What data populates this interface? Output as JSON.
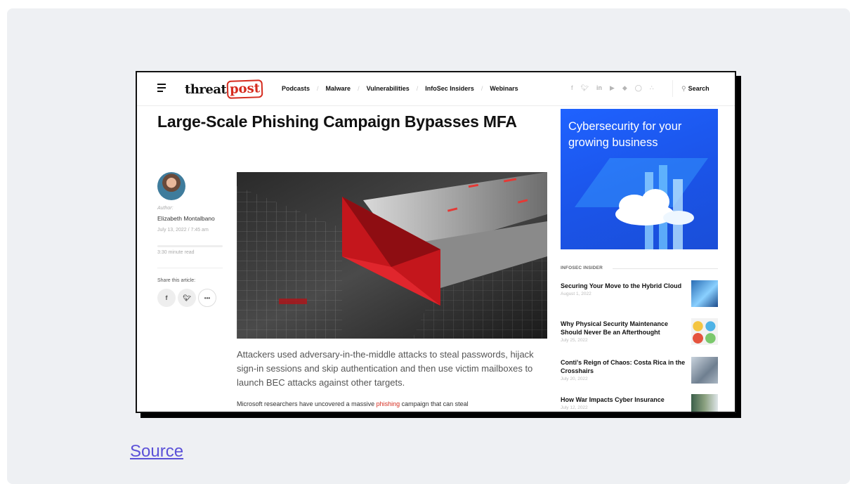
{
  "nav": {
    "logo_part1": "threat",
    "logo_part2": "post",
    "items": [
      "Podcasts",
      "Malware",
      "Vulnerabilities",
      "InfoSec Insiders",
      "Webinars"
    ],
    "social_icons": [
      "facebook-icon",
      "twitter-icon",
      "linkedin-icon",
      "youtube-icon",
      "feedly-icon",
      "instagram-icon",
      "rss-icon"
    ],
    "search_label": "Search"
  },
  "article": {
    "title": "Large-Scale Phishing Campaign Bypasses MFA",
    "author_label": "Author:",
    "author": "Elizabeth Montalbano",
    "date": "July 13, 2022 / 7:45 am",
    "read_time": "3:30 minute read",
    "share_label": "Share this article:",
    "lede": "Attackers used adversary-in-the-middle attacks to steal passwords, hijack sign-in sessions and skip authentication and then use victim mailboxes to launch BEC attacks against other targets.",
    "body_before": "Microsoft researchers have uncovered a massive ",
    "body_link": "phishing",
    "body_after": " campaign that can steal"
  },
  "sidebar": {
    "ad_text": "Cybersecurity for your growing business",
    "section_label": "INFOSEC INSIDER",
    "items": [
      {
        "title": "Securing Your Move to the Hybrid Cloud",
        "date": "August 1, 2022"
      },
      {
        "title": "Why Physical Security Maintenance Should Never Be an Afterthought",
        "date": "July 25, 2022"
      },
      {
        "title": "Conti's Reign of Chaos: Costa Rica in the Crosshairs",
        "date": "July 20, 2022"
      },
      {
        "title": "How War Impacts Cyber Insurance",
        "date": "July 12, 2022"
      }
    ]
  },
  "source_label": "Source",
  "colors": {
    "brand_red": "#d52b1e",
    "ad_blue": "#1f62ff",
    "link_purple": "#5b51d8"
  }
}
